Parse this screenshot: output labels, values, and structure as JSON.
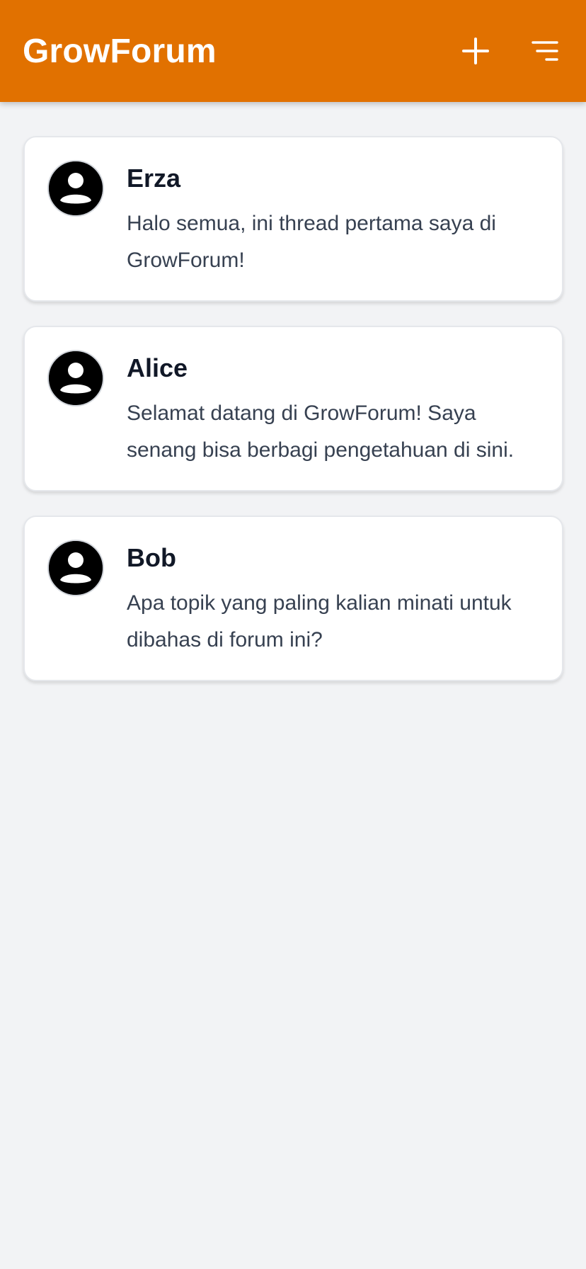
{
  "header": {
    "title": "GrowForum",
    "actions": [
      {
        "icon": "plus-icon"
      },
      {
        "icon": "menu-icon"
      }
    ],
    "color": "#e17100"
  },
  "threads": [
    {
      "author": "Erza",
      "body": "Halo semua, ini thread pertama saya di GrowForum!",
      "avatar_icon": "user-avatar-icon"
    },
    {
      "author": "Alice",
      "body": "Selamat datang di GrowForum! Saya senang bisa berbagi pengetahuan di sini.",
      "avatar_icon": "user-avatar-icon"
    },
    {
      "author": "Bob",
      "body": "Apa topik yang paling kalian minati untuk dibahas di forum ini?",
      "avatar_icon": "user-avatar-icon"
    }
  ],
  "colors": {
    "background": "#f2f3f5",
    "card": "#ffffff",
    "author_text": "#111827",
    "body_text": "#374151"
  }
}
